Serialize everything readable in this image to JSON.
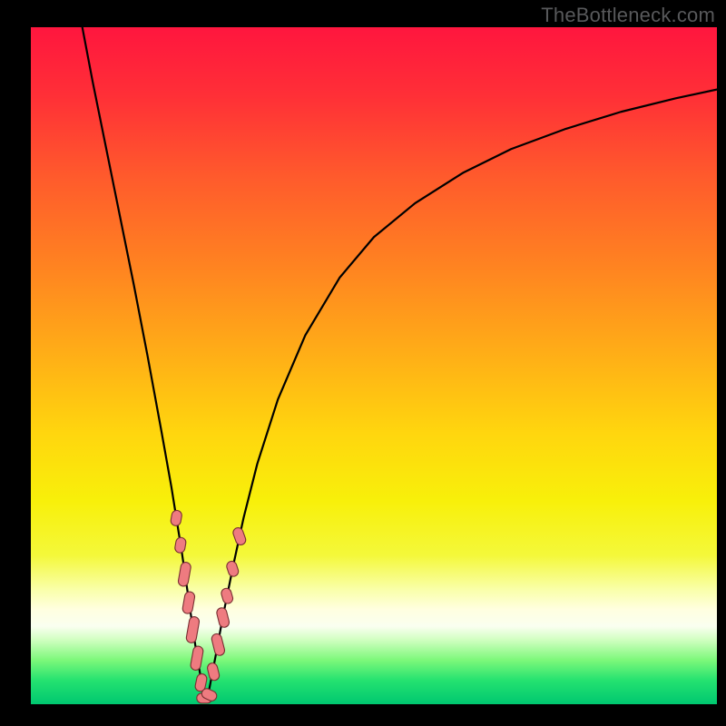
{
  "watermark": "TheBottleneck.com",
  "frame": {
    "outer_width": 800,
    "outer_height": 800,
    "left_border": 34,
    "right_border": 10,
    "top_border": 30,
    "bottom_border": 24
  },
  "gradient": {
    "stops": [
      {
        "offset": 0.0,
        "color": "#ff163e"
      },
      {
        "offset": 0.1,
        "color": "#ff2f37"
      },
      {
        "offset": 0.22,
        "color": "#ff5a2c"
      },
      {
        "offset": 0.35,
        "color": "#ff8221"
      },
      {
        "offset": 0.48,
        "color": "#ffad17"
      },
      {
        "offset": 0.6,
        "color": "#ffd60e"
      },
      {
        "offset": 0.7,
        "color": "#f8f00a"
      },
      {
        "offset": 0.78,
        "color": "#f4f83a"
      },
      {
        "offset": 0.83,
        "color": "#f9ffa8"
      },
      {
        "offset": 0.86,
        "color": "#ffffe0"
      },
      {
        "offset": 0.885,
        "color": "#fafff0"
      },
      {
        "offset": 0.905,
        "color": "#d0ffc0"
      },
      {
        "offset": 0.935,
        "color": "#7cf87a"
      },
      {
        "offset": 0.965,
        "color": "#24e270"
      },
      {
        "offset": 1.0,
        "color": "#00c870"
      }
    ]
  },
  "curve": {
    "stroke": "#000000",
    "stroke_width": 2.2
  },
  "markers": {
    "fill": "#ee7b80",
    "stroke": "#782f32",
    "stroke_width": 1.1
  },
  "chart_data": {
    "type": "line",
    "title": "",
    "xlabel": "",
    "ylabel": "",
    "xlim": [
      0,
      100
    ],
    "ylim": [
      0,
      100
    ],
    "x_dip": 25.5,
    "curve_points": [
      {
        "x": 7.5,
        "y": 100.0
      },
      {
        "x": 9.0,
        "y": 92.0
      },
      {
        "x": 11.0,
        "y": 82.0
      },
      {
        "x": 13.0,
        "y": 72.0
      },
      {
        "x": 15.0,
        "y": 62.0
      },
      {
        "x": 17.0,
        "y": 51.5
      },
      {
        "x": 19.0,
        "y": 40.5
      },
      {
        "x": 20.5,
        "y": 32.0
      },
      {
        "x": 22.0,
        "y": 22.5
      },
      {
        "x": 23.0,
        "y": 15.5
      },
      {
        "x": 24.0,
        "y": 8.5
      },
      {
        "x": 25.0,
        "y": 2.5
      },
      {
        "x": 25.5,
        "y": 0.4
      },
      {
        "x": 26.0,
        "y": 2.2
      },
      {
        "x": 27.0,
        "y": 7.5
      },
      {
        "x": 28.0,
        "y": 13.0
      },
      {
        "x": 29.5,
        "y": 20.5
      },
      {
        "x": 31.0,
        "y": 27.5
      },
      {
        "x": 33.0,
        "y": 35.5
      },
      {
        "x": 36.0,
        "y": 45.0
      },
      {
        "x": 40.0,
        "y": 54.5
      },
      {
        "x": 45.0,
        "y": 63.0
      },
      {
        "x": 50.0,
        "y": 69.0
      },
      {
        "x": 56.0,
        "y": 74.0
      },
      {
        "x": 63.0,
        "y": 78.5
      },
      {
        "x": 70.0,
        "y": 82.0
      },
      {
        "x": 78.0,
        "y": 85.0
      },
      {
        "x": 86.0,
        "y": 87.5
      },
      {
        "x": 94.0,
        "y": 89.5
      },
      {
        "x": 100.0,
        "y": 90.8
      }
    ],
    "series": [
      {
        "name": "left-branch-markers",
        "shape": "pill",
        "points": [
          {
            "x": 21.2,
            "y": 27.5,
            "len": 1.4,
            "angle": -80
          },
          {
            "x": 21.8,
            "y": 23.5,
            "len": 1.4,
            "angle": -80
          },
          {
            "x": 22.4,
            "y": 19.2,
            "len": 2.2,
            "angle": -80
          },
          {
            "x": 23.0,
            "y": 15.0,
            "len": 2.0,
            "angle": -80
          },
          {
            "x": 23.6,
            "y": 11.0,
            "len": 2.4,
            "angle": -80
          },
          {
            "x": 24.2,
            "y": 6.8,
            "len": 2.2,
            "angle": -80
          },
          {
            "x": 24.8,
            "y": 3.2,
            "len": 1.6,
            "angle": -78
          }
        ]
      },
      {
        "name": "bottom-markers",
        "shape": "pill",
        "points": [
          {
            "x": 25.3,
            "y": 0.9,
            "len": 1.4,
            "angle": 0
          },
          {
            "x": 26.0,
            "y": 1.4,
            "len": 1.4,
            "angle": 25
          }
        ]
      },
      {
        "name": "right-branch-markers",
        "shape": "pill",
        "points": [
          {
            "x": 26.6,
            "y": 4.8,
            "len": 1.6,
            "angle": 76
          },
          {
            "x": 27.3,
            "y": 8.8,
            "len": 2.0,
            "angle": 76
          },
          {
            "x": 28.0,
            "y": 12.8,
            "len": 1.8,
            "angle": 76
          },
          {
            "x": 28.6,
            "y": 16.0,
            "len": 1.4,
            "angle": 74
          },
          {
            "x": 29.4,
            "y": 20.0,
            "len": 1.4,
            "angle": 72
          },
          {
            "x": 30.4,
            "y": 24.8,
            "len": 1.6,
            "angle": 70
          }
        ]
      }
    ]
  }
}
